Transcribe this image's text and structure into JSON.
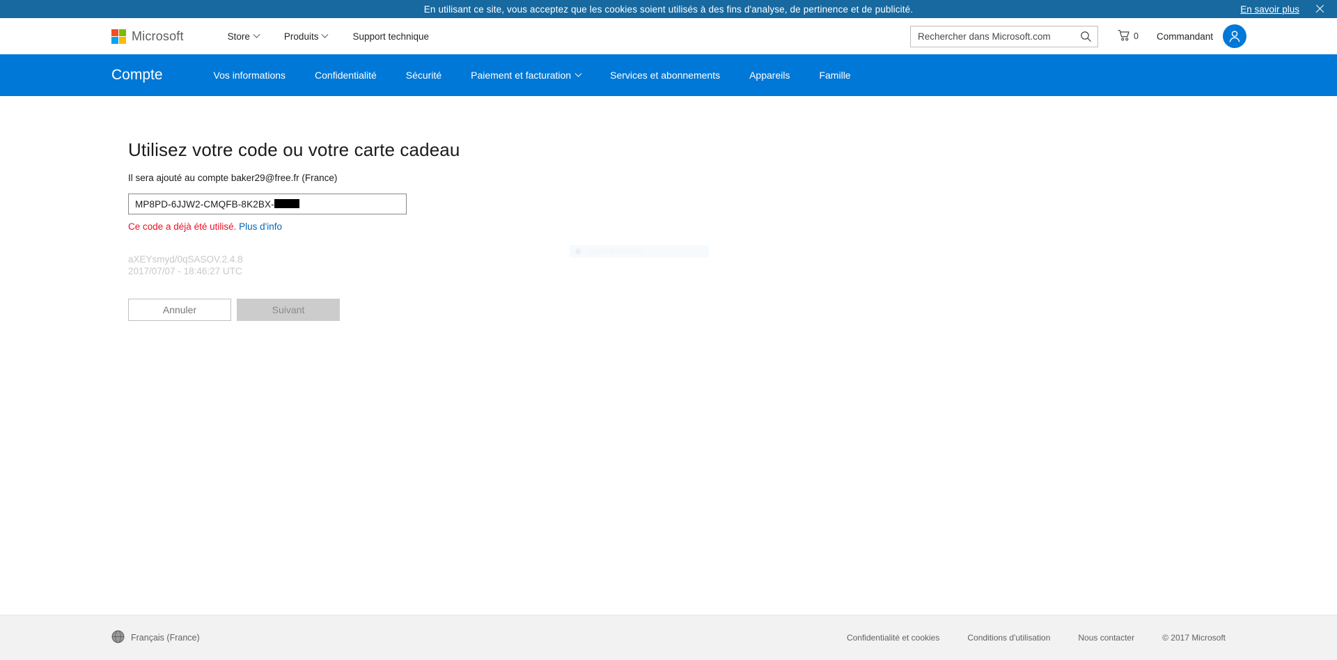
{
  "cookie_banner": {
    "message": "En utilisant ce site, vous acceptez que les cookies soient utilisés à des fins d'analyse, de pertinence et de publicité.",
    "learn_more": "En savoir plus",
    "close_icon": "close-icon",
    "background": "#17699f"
  },
  "header": {
    "logo_text": "Microsoft",
    "logo_icon": "microsoft-logo-icon",
    "nav": [
      {
        "label": "Store",
        "has_caret": true
      },
      {
        "label": "Produits",
        "has_caret": true
      },
      {
        "label": "Support technique",
        "has_caret": false
      }
    ],
    "search": {
      "placeholder": "Rechercher dans Microsoft.com",
      "value": "",
      "icon": "search-icon"
    },
    "cart": {
      "icon": "cart-icon",
      "count": "0"
    },
    "username": "Commandant",
    "avatar_icon": "user-avatar-icon"
  },
  "account_nav": {
    "brand": "Compte",
    "background": "#0078d7",
    "items": [
      {
        "label": "Vos informations",
        "has_caret": false
      },
      {
        "label": "Confidentialité",
        "has_caret": false
      },
      {
        "label": "Sécurité",
        "has_caret": false
      },
      {
        "label": "Paiement et facturation",
        "has_caret": true
      },
      {
        "label": "Services et abonnements",
        "has_caret": false
      },
      {
        "label": "Appareils",
        "has_caret": false
      },
      {
        "label": "Famille",
        "has_caret": false
      }
    ]
  },
  "main": {
    "title": "Utilisez votre code ou votre carte cadeau",
    "subtitle": "Il sera ajouté au compte baker29@free.fr (France)",
    "code_input": {
      "value": "MP8PD-6JJW2-CMQFB-8K2BX-",
      "redacted": true
    },
    "error": {
      "message": "Ce code a déjà été utilisé.",
      "link": "Plus d'info",
      "color": "#e81123"
    },
    "diagnostics": {
      "line1": "aXEYsmyd/0qSASOV.2.4.8",
      "line2": "2017/07/07 - 18:46:27 UTC"
    },
    "buttons": {
      "cancel": "Annuler",
      "next": "Suivant"
    },
    "ghost_overlay": {
      "label": "Capture Fenêtre"
    }
  },
  "footer": {
    "language": "Français (France)",
    "globe_icon": "globe-icon",
    "links": [
      "Confidentialité et cookies",
      "Conditions d'utilisation",
      "Nous contacter"
    ],
    "copyright": "© 2017 Microsoft"
  }
}
